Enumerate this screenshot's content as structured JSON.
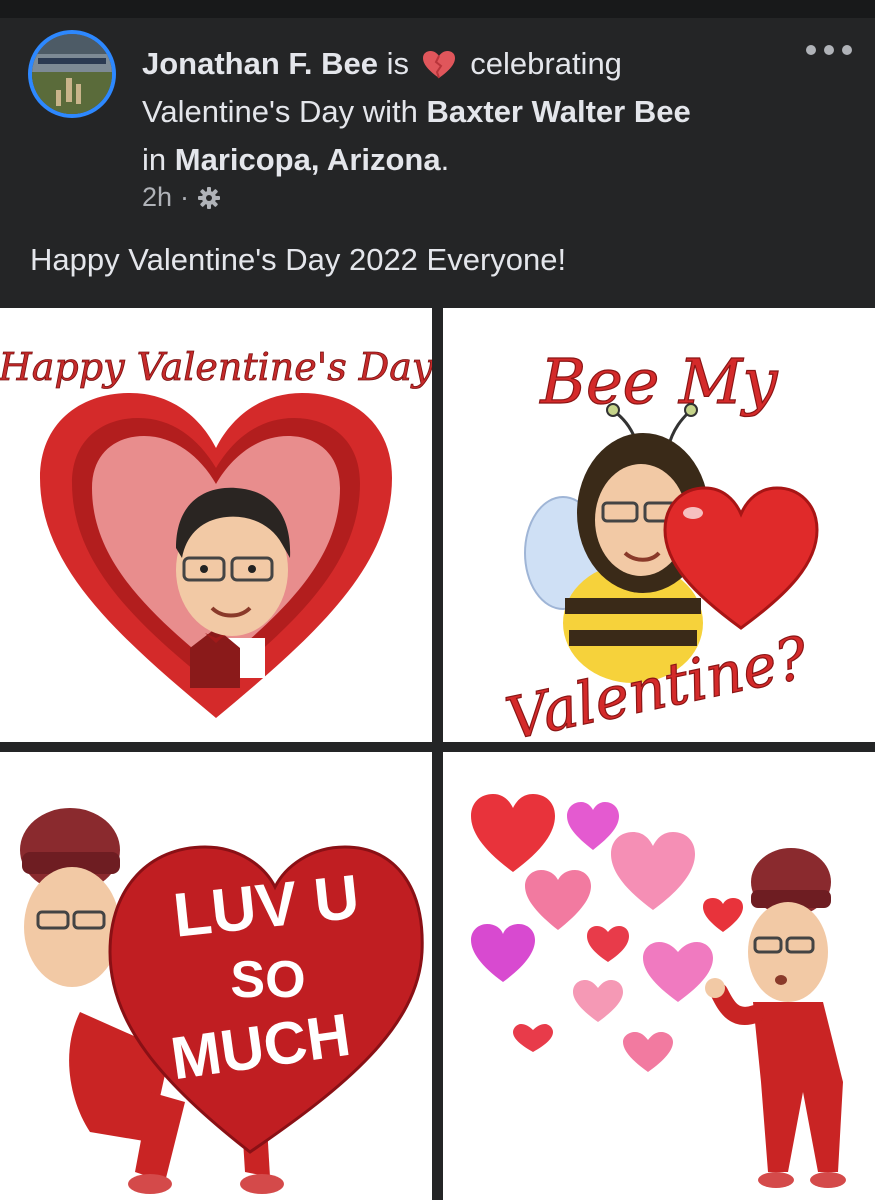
{
  "post": {
    "author": "Jonathan F. Bee",
    "is_text": "is",
    "feeling_text": "celebrating",
    "activity_line": "Valentine's Day with",
    "tagged_person": "Baxter Walter Bee",
    "in_text": "in",
    "location": "Maricopa, Arizona",
    "period": ".",
    "time_ago": "2h",
    "separator": "·",
    "privacy_icon": "gear-icon",
    "body": "Happy Valentine's Day 2022 Everyone!"
  },
  "images": {
    "tile1": {
      "text": "Happy Valentine's Day"
    },
    "tile2": {
      "line1": "Bee My",
      "line2": "Valentine?"
    },
    "tile3": {
      "line1": "LUV U",
      "line2": "SO",
      "line3": "MUCH"
    }
  },
  "colors": {
    "background": "#242526",
    "text": "#e4e6eb",
    "muted": "#b0b3b8",
    "avatar_ring": "#2d88ff",
    "heart_red": "#d42a2a"
  }
}
